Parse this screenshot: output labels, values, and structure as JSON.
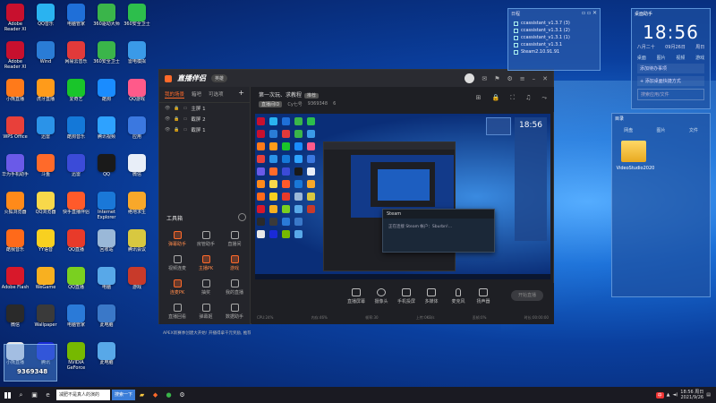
{
  "desktop": {
    "icons": [
      {
        "label": "Adobe Reader XI",
        "color": "#c8102e"
      },
      {
        "label": "QQ音乐",
        "color": "#2ab3f0"
      },
      {
        "label": "电脑管家",
        "color": "#1f6fd8"
      },
      {
        "label": "360驱动大师",
        "color": "#3ab54a"
      },
      {
        "label": "360安全卫士",
        "color": "#2dbe4c"
      },
      {
        "label": "Adobe Reader XI",
        "color": "#c8102e"
      },
      {
        "label": "Wind",
        "color": "#2a7cd6"
      },
      {
        "label": "网易云音乐",
        "color": "#e23a3a"
      },
      {
        "label": "360安全卫士",
        "color": "#3ab54a"
      },
      {
        "label": "雷电模拟",
        "color": "#3a9ae8"
      },
      {
        "label": "小熊直播",
        "color": "#ff7a1a"
      },
      {
        "label": "虎牙直播",
        "color": "#ff9b1a"
      },
      {
        "label": "爱奇艺",
        "color": "#19c52a"
      },
      {
        "label": "酷狗",
        "color": "#1a8cff"
      },
      {
        "label": "QQ游戏",
        "color": "#ff5a8a"
      },
      {
        "label": "WPS Office",
        "color": "#e8403a"
      },
      {
        "label": "迅雷",
        "color": "#2b93e8"
      },
      {
        "label": "酷狗音乐",
        "color": "#1478d8"
      },
      {
        "label": "腾讯视频",
        "color": "#2ea2ff"
      },
      {
        "label": "应用",
        "color": "#3b78e0"
      },
      {
        "label": "华为手机助手",
        "color": "#6a5ae8"
      },
      {
        "label": "斗鱼",
        "color": "#ff6a2a"
      },
      {
        "label": "迅雷",
        "color": "#3b4bd8"
      },
      {
        "label": "QQ",
        "color": "#1a1a1a"
      },
      {
        "label": "微信",
        "color": "#e8eef8"
      },
      {
        "label": "火狐浏览器",
        "color": "#ff8a1a"
      },
      {
        "label": "QQ浏览器",
        "color": "#f8d84a"
      },
      {
        "label": "快手直播伴侣",
        "color": "#ff5a2a"
      },
      {
        "label": "Internet Explorer",
        "color": "#1a78d8"
      },
      {
        "label": "绝地求生",
        "color": "#f8a82a"
      },
      {
        "label": "酷我音乐",
        "color": "#ff6a1a"
      },
      {
        "label": "YY语音",
        "color": "#f8d020"
      },
      {
        "label": "QQ直播",
        "color": "#e83a2a"
      },
      {
        "label": "回收站",
        "color": "#9ab8d8"
      },
      {
        "label": "腾讯会议",
        "color": "#d8c840"
      },
      {
        "label": "Adobe Flash",
        "color": "#d8182a"
      },
      {
        "label": "WeGame",
        "color": "#f8b020"
      },
      {
        "label": "QQ直播",
        "color": "#7ad020"
      },
      {
        "label": "电脑",
        "color": "#58a8e8"
      },
      {
        "label": "游戏",
        "color": "#c83a2a"
      },
      {
        "label": "微信",
        "color": "#2a2a2a"
      },
      {
        "label": "Wallpaper",
        "color": "#3a3a3a"
      },
      {
        "label": "电脑管家",
        "color": "#2a7ad8"
      },
      {
        "label": "此电脑",
        "color": "#3a78c8"
      },
      {
        "label": "",
        "color": "transparent"
      },
      {
        "label": "小熊直播",
        "color": "#e8e8e8"
      },
      {
        "label": "腾讯",
        "color": "#1a2ad8"
      },
      {
        "label": "NVIDIA GeForce",
        "color": "#76b900"
      },
      {
        "label": "此电脑",
        "color": "#58a8e8"
      },
      {
        "label": "",
        "color": "transparent"
      }
    ],
    "overlay_badge": "9369348"
  },
  "app": {
    "logo": "直播伴侣",
    "badge": "英雄",
    "tabs": [
      "我的场景",
      "箱吧",
      "可选项"
    ],
    "scenes": [
      "主屏 1",
      "截屏 2",
      "截屏 1"
    ],
    "toolbox_title": "工具箱",
    "tools": [
      "弹幕助手",
      "房管助手",
      "直播间",
      "视频连麦",
      "主播PK",
      "游戏",
      "连麦PK",
      "抽奖",
      "我的直播",
      "直播回看",
      "弹幕姬",
      "数据助手"
    ],
    "marquee": "APEX新赛季创建大开始! 开播得拿千元奖励, 推荐已经进入视频路!",
    "scene_title": "第一次玩、求教程",
    "scene_tag": "推荐",
    "scene_info": [
      "直播间ID",
      "Cy七号",
      "9369348",
      "6"
    ],
    "preview": {
      "steam_title": "Steam",
      "steam_msg": "正在连接 Steam 帐户：Sburbn!..."
    },
    "controls": [
      "直播屏幕",
      "摄像头",
      "手机投屏",
      "多媒体",
      "麦克风",
      "扬声器"
    ],
    "go_live": "开始直播",
    "stats": [
      "CPU:24%",
      "内存:46%",
      "帧率:30",
      "上传:0KB/s",
      "丢帧:0%",
      "时长:00:00:00"
    ]
  },
  "notes_widget": {
    "title": "日程",
    "items": [
      "ccassistant_v1.3.7 (3)",
      "ccassistant_v1.3.1 (2)",
      "ccassistant_v1.3.1 (1)",
      "ccassistant_v1.3.1",
      "Steam2.10.91.91"
    ]
  },
  "clock_widget": {
    "title": "桌面助手",
    "time": "18:56",
    "lunar": "八月二十",
    "date": "09月26日",
    "weekday": "周日",
    "links": [
      "桌面",
      "图片",
      "视频",
      "游戏"
    ],
    "todo": "添加待办事项",
    "add_link": "+ 添加桌面快捷方式",
    "search_placeholder": "搜索应用/文件"
  },
  "dir_widget": {
    "title": "目录",
    "cats": [
      "网盘",
      "图片",
      "文件"
    ],
    "folder": "VideoStudio2020"
  },
  "taskbar": {
    "search_value": "减肥不是真人的演的",
    "search_btn": "搜索一下",
    "time": "18:56 周日",
    "date": "2021/9/26",
    "ime": "中"
  }
}
